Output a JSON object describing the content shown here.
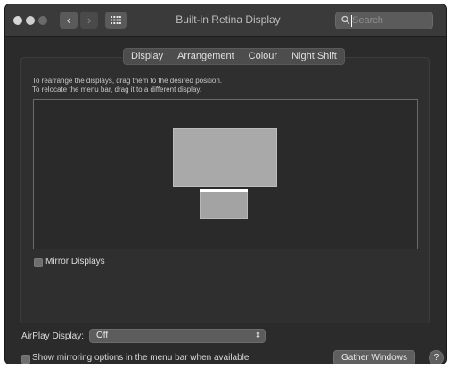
{
  "window": {
    "title": "Built-in Retina Display"
  },
  "toolbar": {
    "back_icon": "chevron-left-icon",
    "forward_icon": "chevron-right-icon",
    "grid_icon": "grid-icon",
    "search_placeholder": "Search"
  },
  "tabs": [
    {
      "label": "Display"
    },
    {
      "label": "Arrangement",
      "selected": true
    },
    {
      "label": "Colour"
    },
    {
      "label": "Night Shift"
    }
  ],
  "arrangement": {
    "instruction_line1": "To rearrange the displays, drag them to the desired position.",
    "instruction_line2": "To relocate the menu bar, drag it to a different display.",
    "mirror_label": "Mirror Displays",
    "mirror_checked": false
  },
  "airplay": {
    "label": "AirPlay Display:",
    "value": "Off"
  },
  "footer": {
    "show_mirroring_label": "Show mirroring options in the menu bar when available",
    "show_mirroring_checked": false,
    "gather_label": "Gather Windows",
    "help_label": "?"
  }
}
